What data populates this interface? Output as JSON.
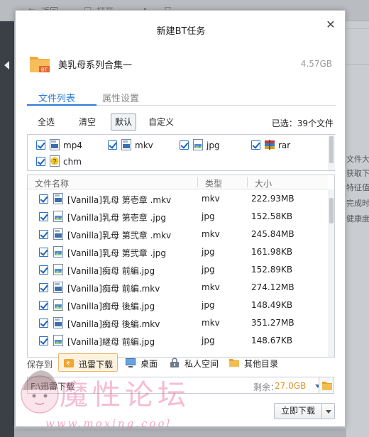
{
  "background": {
    "toolbar": {
      "back_label": "返回",
      "open_label": "打开"
    },
    "right_panel_lines": [
      "文件大",
      "获取下",
      "特征值",
      "完成时",
      "健康度"
    ]
  },
  "dialog": {
    "title": "新建BT任务",
    "close_icon": "close-icon",
    "task": {
      "name": "美乳母系列合集一",
      "size": "4.57GB",
      "icon": "bt-folder-icon",
      "icon_badge": "BT"
    },
    "tabs": [
      {
        "label": "文件列表",
        "active": true
      },
      {
        "label": "属性设置",
        "active": false
      }
    ],
    "filters": {
      "all": "全选",
      "clear": "清空",
      "default": "默认",
      "custom": "自定义",
      "active": "default"
    },
    "selected_count": "已选：39个文件",
    "file_types": [
      {
        "label": "mp4",
        "checked": true,
        "icon": "video-file-icon"
      },
      {
        "label": "mkv",
        "checked": true,
        "icon": "video-file-icon"
      },
      {
        "label": "jpg",
        "checked": true,
        "icon": "image-file-icon"
      },
      {
        "label": "rar",
        "checked": true,
        "icon": "archive-file-icon"
      },
      {
        "label": "chm",
        "checked": true,
        "icon": "help-file-icon"
      }
    ],
    "list": {
      "columns": {
        "name": "文件名称",
        "type": "类型",
        "size": "大小"
      },
      "rows": [
        {
          "name": "[Vanilla]乳母 第壱章 .mkv",
          "type": "mkv",
          "size": "222.93MB",
          "icon": "video-file-icon",
          "checked": true
        },
        {
          "name": "[Vanilla]乳母 第壱章 .jpg",
          "type": "jpg",
          "size": "152.58KB",
          "icon": "image-file-icon",
          "checked": true
        },
        {
          "name": "[Vanilla]乳母 第弐章 .mkv",
          "type": "mkv",
          "size": "245.84MB",
          "icon": "video-file-icon",
          "checked": true
        },
        {
          "name": "[Vanilla]乳母 第弐章 .jpg",
          "type": "jpg",
          "size": "161.98KB",
          "icon": "image-file-icon",
          "checked": true
        },
        {
          "name": "[Vanilla]痴母 前編.jpg",
          "type": "jpg",
          "size": "152.89KB",
          "icon": "image-file-icon",
          "checked": true
        },
        {
          "name": "[Vanilla]痴母 前編.mkv",
          "type": "mkv",
          "size": "274.12MB",
          "icon": "video-file-icon",
          "checked": true
        },
        {
          "name": "[Vanilla]痴母 後編.jpg",
          "type": "jpg",
          "size": "148.49KB",
          "icon": "image-file-icon",
          "checked": true
        },
        {
          "name": "[Vanilla]痴母 後編.mkv",
          "type": "mkv",
          "size": "351.27MB",
          "icon": "video-file-icon",
          "checked": true
        },
        {
          "name": "[Vanilla]継母 前編.jpg",
          "type": "jpg",
          "size": "148.67KB",
          "icon": "image-file-icon",
          "checked": true
        }
      ]
    },
    "save": {
      "label": "保存到",
      "locations": [
        {
          "label": "迅雷下载",
          "icon": "thunder-download-icon",
          "active": true
        },
        {
          "label": "桌面",
          "icon": "desktop-icon",
          "active": false
        },
        {
          "label": "私人空间",
          "icon": "private-space-icon",
          "active": false
        },
        {
          "label": "其他目录",
          "icon": "folder-icon",
          "active": false
        }
      ],
      "path": "F:\\迅雷下载",
      "free_label": "剩余：",
      "free_value": "27.0GB"
    },
    "download_button": "立即下载"
  },
  "watermark": {
    "text": "魔性论坛",
    "url": "www.moxing.cool"
  },
  "colors": {
    "accent": "#2b7bd6",
    "free_space": "#e0942a",
    "watermark": "#e86096"
  }
}
